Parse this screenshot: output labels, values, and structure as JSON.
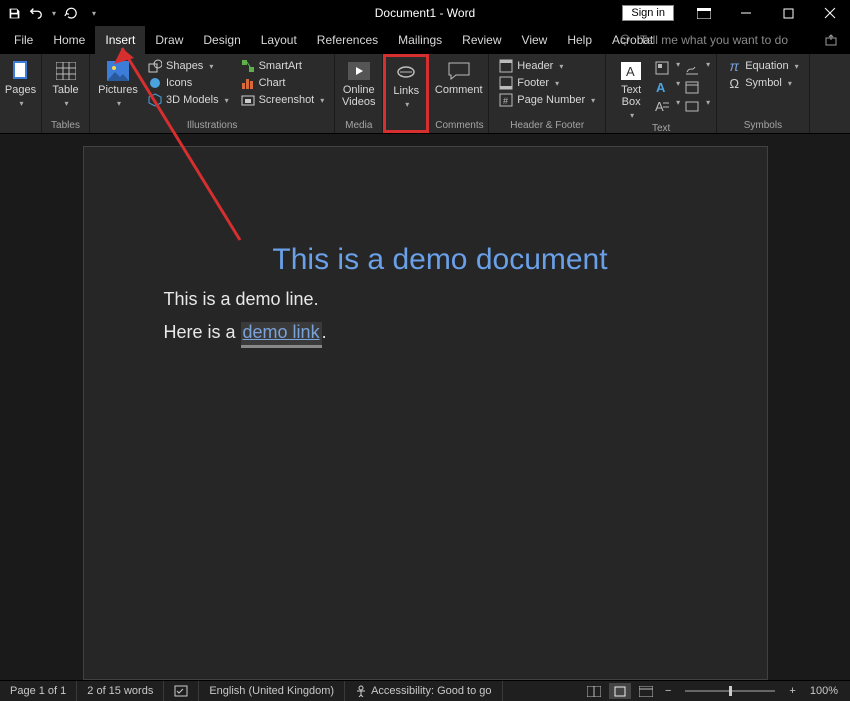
{
  "titlebar": {
    "title": "Document1 - Word",
    "signin": "Sign in"
  },
  "tabs": {
    "file": "File",
    "home": "Home",
    "insert": "Insert",
    "draw": "Draw",
    "design": "Design",
    "layout": "Layout",
    "references": "References",
    "mailings": "Mailings",
    "review": "Review",
    "view": "View",
    "help": "Help",
    "acrobat": "Acrobat",
    "tell_placeholder": "Tell me what you want to do"
  },
  "ribbon": {
    "pages": "Pages",
    "table": "Table",
    "pictures": "Pictures",
    "shapes": "Shapes",
    "icons": "Icons",
    "models": "3D Models",
    "smartart": "SmartArt",
    "chart": "Chart",
    "screenshot": "Screenshot",
    "online_videos": "Online Videos",
    "links": "Links",
    "comment": "Comment",
    "header": "Header",
    "footer": "Footer",
    "page_number": "Page Number",
    "text_box": "Text Box",
    "equation": "Equation",
    "symbol": "Symbol",
    "groups": {
      "tables": "Tables",
      "illustrations": "Illustrations",
      "media": "Media",
      "comments": "Comments",
      "hf": "Header & Footer",
      "text": "Text",
      "symbols": "Symbols"
    }
  },
  "doc": {
    "title": "This is a demo document",
    "line1": "This is a demo line.",
    "line2_pre": "Here is a ",
    "link": "demo link",
    "line2_post": "."
  },
  "status": {
    "page": "Page 1 of 1",
    "words": "2 of 15 words",
    "lang": "English (United Kingdom)",
    "access": "Accessibility: Good to go",
    "zoom": "100%"
  }
}
